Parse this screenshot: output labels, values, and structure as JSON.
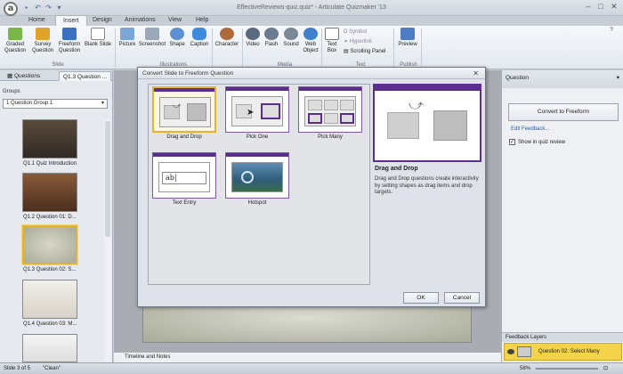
{
  "window": {
    "title": "EffectiveReviews-quiz.quiz* - Articulate Quizmaker '13",
    "app_logo": "a"
  },
  "menu": {
    "tabs": [
      "Home",
      "Insert",
      "Design",
      "Animations",
      "View",
      "Help"
    ],
    "active": "Insert"
  },
  "ribbon": {
    "buttons": [
      {
        "label": "Graded\nQuestion",
        "icon": "graded-question-icon"
      },
      {
        "label": "Survey\nQuestion",
        "icon": "survey-question-icon"
      },
      {
        "label": "Freeform\nQuestion",
        "icon": "freeform-question-icon"
      },
      {
        "label": "Blank Slide",
        "icon": "blank-slide-icon"
      },
      {
        "label": "Picture",
        "icon": "picture-icon"
      },
      {
        "label": "Screenshot",
        "icon": "screenshot-icon"
      },
      {
        "label": "Shape",
        "icon": "shape-icon"
      },
      {
        "label": "Caption",
        "icon": "caption-icon"
      },
      {
        "label": "Character",
        "icon": "character-icon"
      },
      {
        "label": "Video",
        "icon": "video-icon"
      },
      {
        "label": "Flash",
        "icon": "flash-icon"
      },
      {
        "label": "Sound",
        "icon": "sound-icon"
      },
      {
        "label": "Web\nObject",
        "icon": "web-object-icon"
      },
      {
        "label": "Text\nBox",
        "icon": "text-box-icon"
      },
      {
        "label": "Preview",
        "icon": "preview-icon"
      }
    ],
    "small": {
      "symbol": "Symbol",
      "hyperlink": "Hyperlink",
      "scrolling_panel": "Scrolling Panel"
    },
    "groups": {
      "slide": "Slide",
      "illustrations": "Illustrations",
      "media": "Media",
      "text": "Text",
      "publish": "Publish"
    }
  },
  "left_panel": {
    "tabs": [
      "Questions",
      "Q1.3 Question ..."
    ],
    "groups_label": "Groups",
    "group_value": "1 Question Group 1",
    "slides": [
      "Q1.1 Quiz Introduction",
      "Q1.2 Question 01: D...",
      "Q1.3 Question 02: S...",
      "Q1.4 Question 03: M..."
    ]
  },
  "center": {
    "timeline": "Timeline and Notes"
  },
  "right_panel": {
    "title": "Question",
    "convert_button": "Convert to Freeform",
    "edit_feedback": "Edit Feedback...",
    "show_in_review": "Show in quiz review",
    "feedback_layers": "Feedback Layers",
    "layer_name": "Question 02: Select Many"
  },
  "dialog": {
    "title": "Convert Slide to Freeform Question",
    "options": [
      "Drag and Drop",
      "Pick One",
      "Pick Many",
      "Text Entry",
      "Hotspot"
    ],
    "selected": "Drag and Drop",
    "preview_title": "Drag and Drop",
    "preview_desc": "Drag and Drop questions create interactivity by setting shapes as drag items and drop targets.",
    "ok": "OK",
    "cancel": "Cancel"
  },
  "status": {
    "slide": "Slide 3 of 5",
    "theme": "\"Clean\"",
    "zoom": "58%"
  },
  "colors": {
    "accent_purple": "#5b2d8e",
    "selection_gold": "#e6b42a"
  }
}
